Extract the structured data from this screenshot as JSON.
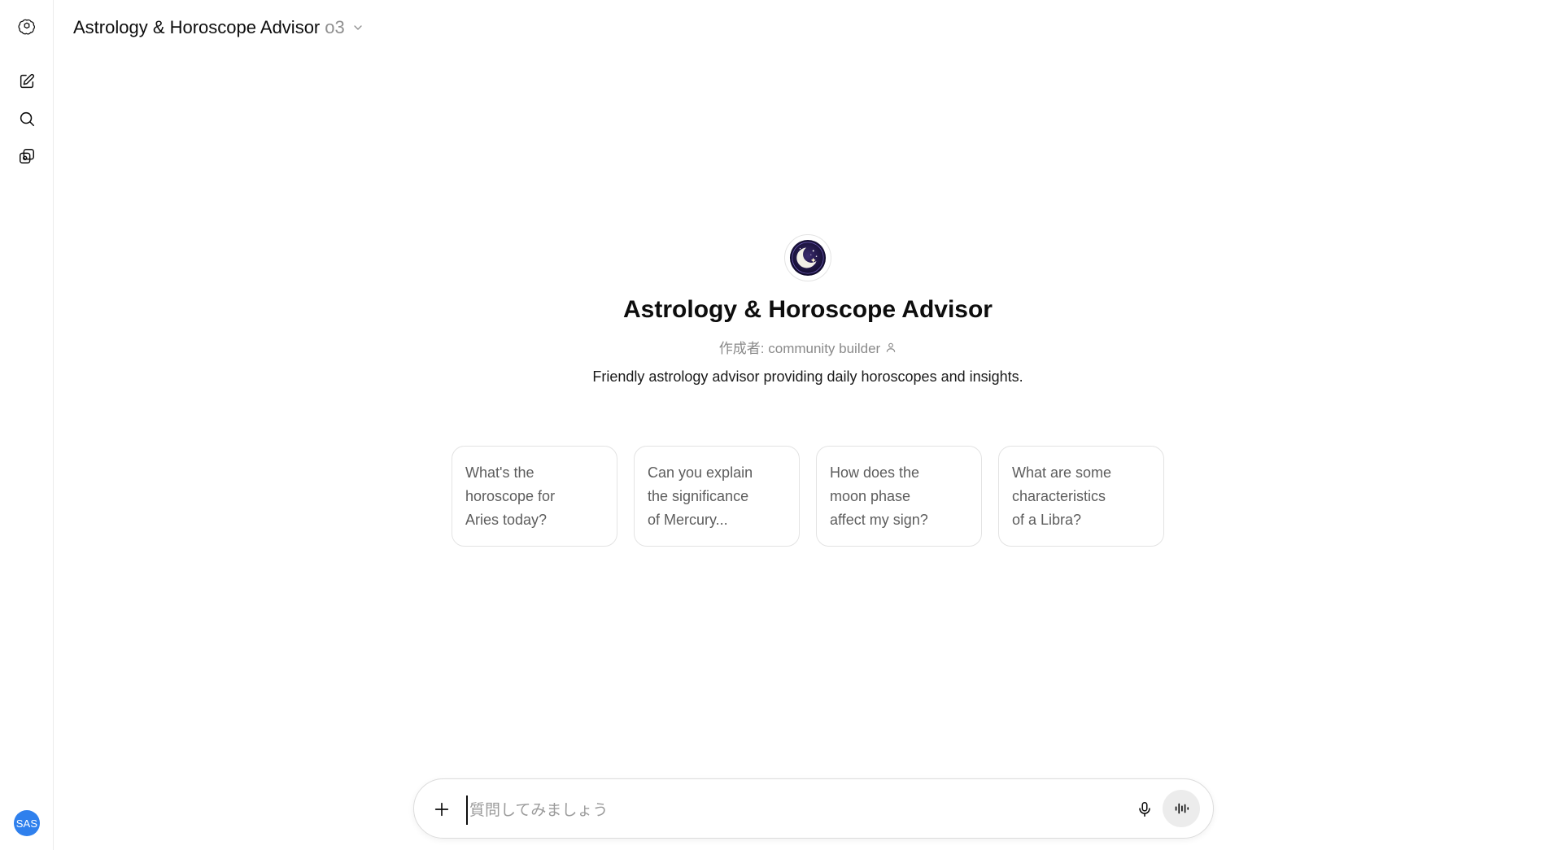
{
  "rail": {
    "logo_icon": "openai-logo-icon",
    "new_chat_icon": "new-chat-icon",
    "search_icon": "search-icon",
    "gpts_icon": "gpts-icon",
    "avatar_initials": "SAS"
  },
  "header": {
    "gpt_name": "Astrology & Horoscope Advisor",
    "model": "o3",
    "dropdown_icon": "chevron-down-icon"
  },
  "hero": {
    "logo_icon": "crescent-moon-stars-icon",
    "title": "Astrology & Horoscope Advisor",
    "author": "作成者: community builder",
    "author_icon": "person-icon",
    "description": "Friendly astrology advisor providing daily horoscopes and insights."
  },
  "suggestions": [
    {
      "line1": "What's the",
      "line2": "horoscope for",
      "line3": "Aries today?"
    },
    {
      "line1": "Can you explain",
      "line2": "the significance",
      "line3": "of Mercury..."
    },
    {
      "line1": "How does the",
      "line2": "moon phase",
      "line3": "affect my sign?"
    },
    {
      "line1": "What are some",
      "line2": "characteristics",
      "line3": "of a Libra?"
    }
  ],
  "composer": {
    "placeholder": "質問してみましょう",
    "value": "",
    "attach_icon": "plus-icon",
    "mic_icon": "microphone-icon",
    "voice_icon": "voice-mode-icon"
  },
  "colors": {
    "avatar_bg": "#2f80ed",
    "voice_button_bg": "#ececec",
    "muted_text": "#8f8f8f"
  }
}
